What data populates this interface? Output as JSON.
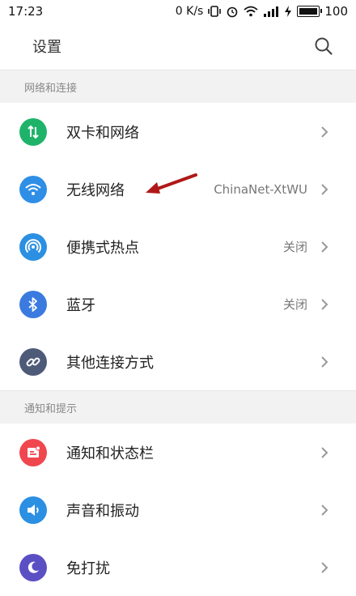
{
  "status": {
    "time": "17:23",
    "netspeed": "0 K/s",
    "battery": "100"
  },
  "header": {
    "title": "设置"
  },
  "sections": [
    {
      "title": "网络和连接",
      "items": [
        {
          "label": "双卡和网络",
          "value": "",
          "icon": "sim-swap-icon",
          "color": "#1fb36a"
        },
        {
          "label": "无线网络",
          "value": "ChinaNet-XtWU",
          "icon": "wifi-icon",
          "color": "#2f8fe6"
        },
        {
          "label": "便携式热点",
          "value": "关闭",
          "icon": "hotspot-icon",
          "color": "#2b8fe2"
        },
        {
          "label": "蓝牙",
          "value": "关闭",
          "icon": "bluetooth-icon",
          "color": "#3b7be0"
        },
        {
          "label": "其他连接方式",
          "value": "",
          "icon": "link-icon",
          "color": "#4e5b78"
        }
      ]
    },
    {
      "title": "通知和提示",
      "items": [
        {
          "label": "通知和状态栏",
          "value": "",
          "icon": "notification-icon",
          "color": "#f0474e"
        },
        {
          "label": "声音和振动",
          "value": "",
          "icon": "sound-icon",
          "color": "#2b8fe2"
        },
        {
          "label": "免打扰",
          "value": "",
          "icon": "moon-icon",
          "color": "#5b4fc4"
        }
      ]
    }
  ]
}
